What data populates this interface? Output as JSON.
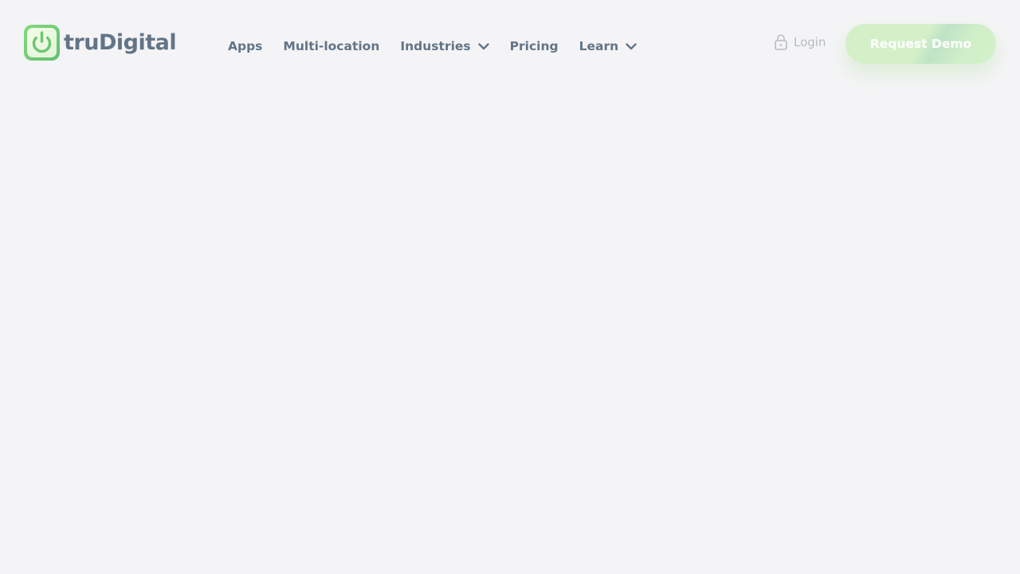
{
  "brand": {
    "name": "truDigital",
    "colors": {
      "accent_green": "#6cc66f",
      "text_slate": "#627487"
    }
  },
  "nav": {
    "items": [
      {
        "label": "Apps",
        "has_dropdown": false
      },
      {
        "label": "Multi-location",
        "has_dropdown": false
      },
      {
        "label": "Industries",
        "has_dropdown": true,
        "icon": "chevron-down-icon"
      },
      {
        "label": "Pricing",
        "has_dropdown": false
      },
      {
        "label": "Learn",
        "has_dropdown": true,
        "icon": "chevron-down-icon"
      }
    ]
  },
  "header_actions": {
    "login_label": "Login",
    "login_icon": "lock-icon",
    "demo_label": "Request Demo"
  }
}
